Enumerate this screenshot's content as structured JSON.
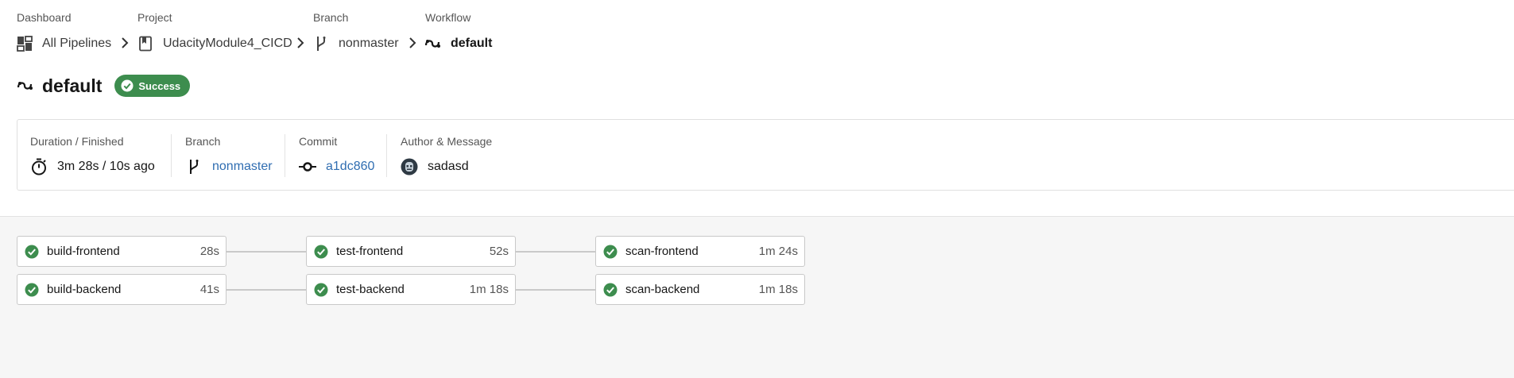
{
  "breadcrumb": [
    {
      "label": "Dashboard",
      "value": "All Pipelines",
      "icon": "dashboard-icon"
    },
    {
      "label": "Project",
      "value": "UdacityModule4_CICD",
      "icon": "bookmark-icon"
    },
    {
      "label": "Branch",
      "value": "nonmaster",
      "icon": "branch-icon"
    },
    {
      "label": "Workflow",
      "value": "default",
      "icon": "workflow-icon"
    }
  ],
  "workflow": {
    "title": "default",
    "status": "Success",
    "status_color": "#3d8d4e"
  },
  "summary": {
    "duration_label": "Duration / Finished",
    "duration_value": "3m 28s / 10s ago",
    "branch_label": "Branch",
    "branch_value": "nonmaster",
    "commit_label": "Commit",
    "commit_value": "a1dc860",
    "author_label": "Author & Message",
    "author_value": "sadasd",
    "link_color": "#2f6db1"
  },
  "jobs": [
    [
      {
        "name": "build-frontend",
        "duration": "28s"
      },
      {
        "name": "build-backend",
        "duration": "41s"
      }
    ],
    [
      {
        "name": "test-frontend",
        "duration": "52s"
      },
      {
        "name": "test-backend",
        "duration": "1m 18s"
      }
    ],
    [
      {
        "name": "scan-frontend",
        "duration": "1m 24s"
      },
      {
        "name": "scan-backend",
        "duration": "1m 18s"
      }
    ]
  ]
}
